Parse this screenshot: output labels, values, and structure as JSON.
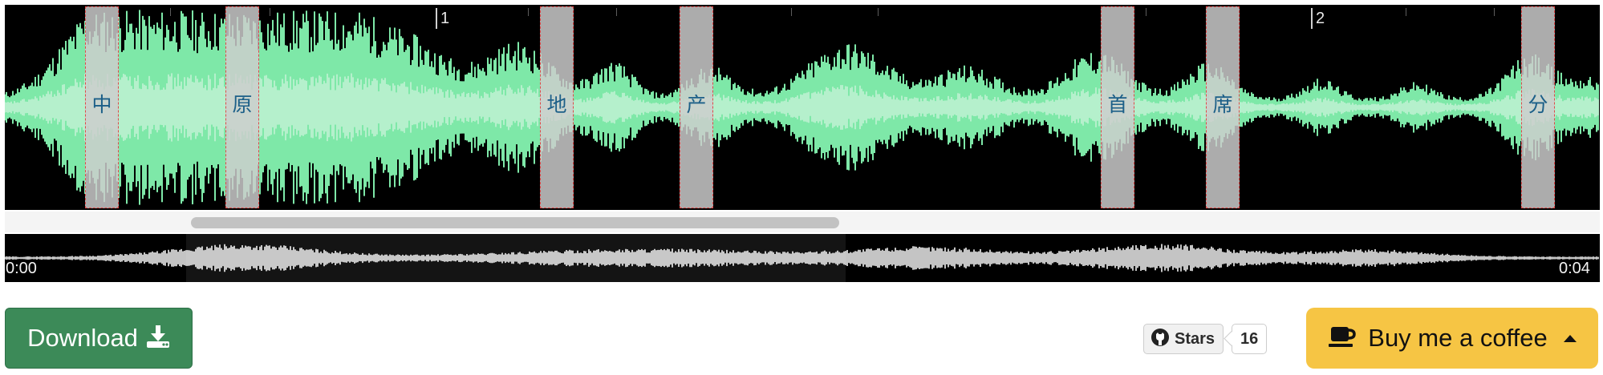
{
  "ruler": {
    "marks": [
      "1",
      "2"
    ]
  },
  "segments": [
    {
      "label": "中"
    },
    {
      "label": "原"
    },
    {
      "label": "地"
    },
    {
      "label": "产"
    },
    {
      "label": "首"
    },
    {
      "label": "席"
    },
    {
      "label": "分"
    }
  ],
  "overview": {
    "start_time": "0:00",
    "end_time": "0:04"
  },
  "download": {
    "label": "Download",
    "icon": "download-icon"
  },
  "github": {
    "icon": "github-icon",
    "stars_label": "Stars",
    "stars_count": "16"
  },
  "coffee": {
    "label": "Buy me a coffee",
    "icon": "coffee-icon",
    "caret_icon": "caret-up-icon"
  },
  "colors": {
    "waveform": "#7ee8a8",
    "waveform_highlight": "#e2f8ea",
    "segment_overlay": "#cdcdcd",
    "segment_border": "#e04848",
    "segment_text": "#1c5f88",
    "overview_wave": "#c4c4c4",
    "download_bg": "#3c8a58",
    "coffee_bg": "#f6c544"
  }
}
